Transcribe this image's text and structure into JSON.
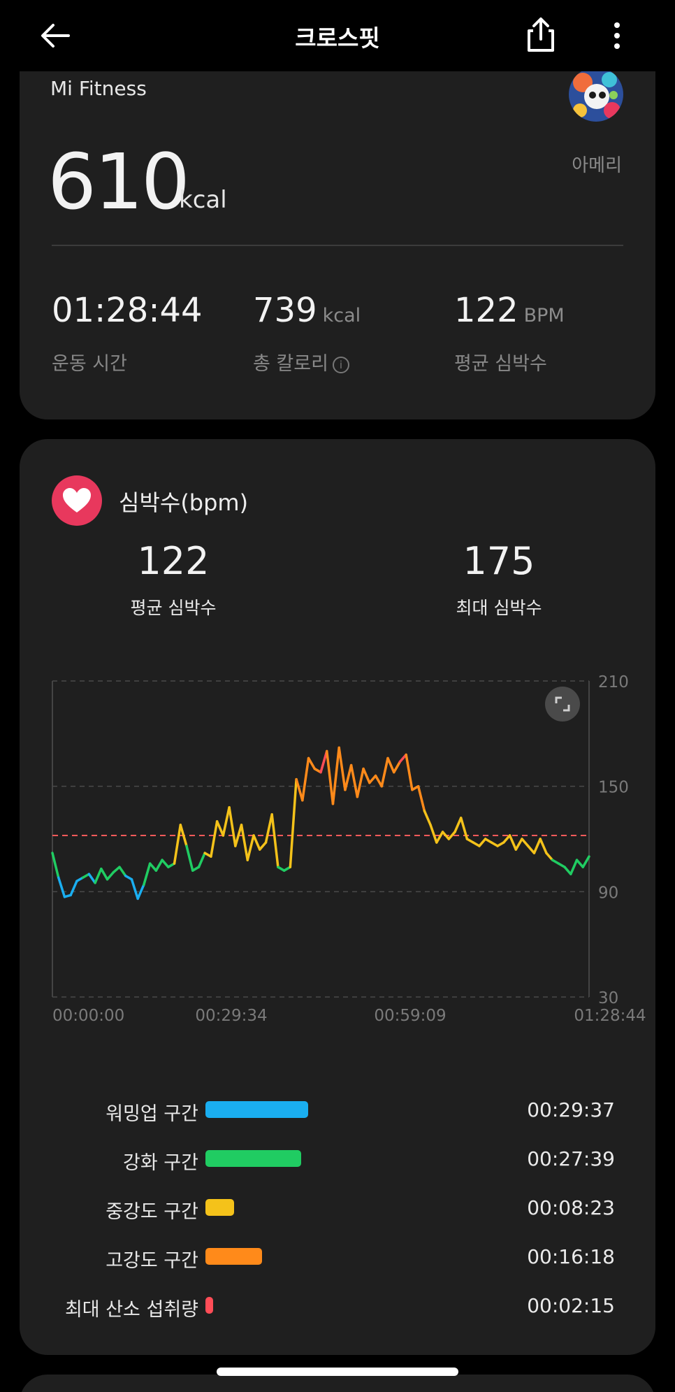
{
  "header": {
    "title": "크로스핏"
  },
  "summary": {
    "app_name": "Mi Fitness",
    "calories_value": "610",
    "calories_unit": "kcal",
    "source_label": "아메리",
    "stats": [
      {
        "value": "01:28:44",
        "unit": "",
        "label": "운동 시간"
      },
      {
        "value": "739",
        "unit": "kcal",
        "label": "총 칼로리"
      },
      {
        "value": "122",
        "unit": "BPM",
        "label": "평균 심박수"
      }
    ]
  },
  "heart_rate": {
    "title": "심박수(bpm)",
    "avg_value": "122",
    "avg_label": "평균 심박수",
    "max_value": "175",
    "max_label": "최대 심박수",
    "colors": {
      "warmup": "#1aaef0",
      "fat_burn": "#20cc62",
      "aerobic": "#f4c21a",
      "anaerobic": "#ff8a1a",
      "vo2max": "#ff4d57",
      "avg_line": "#ff5a5a",
      "heart_bg": "#e8385d"
    }
  },
  "chart_data": {
    "type": "line",
    "ylim": [
      30,
      210
    ],
    "yticks": [
      "210",
      "150",
      "90",
      "30"
    ],
    "xticks": [
      "00:00:00",
      "00:29:34",
      "00:59:09",
      "01:28:44"
    ],
    "avg_line": 122,
    "series": [
      {
        "x_minutes": [
          0,
          1,
          2,
          3,
          4,
          5,
          6,
          7,
          8,
          9,
          10,
          11,
          12,
          13,
          14,
          15,
          16,
          17,
          18,
          19,
          20,
          21,
          22,
          23,
          24,
          25,
          26,
          27,
          28,
          29,
          30,
          31,
          32,
          33,
          34,
          35,
          36,
          37,
          38,
          39,
          40,
          41,
          42,
          43,
          44,
          45,
          46,
          47,
          48,
          49,
          50,
          51,
          52,
          53,
          54,
          55,
          56,
          57,
          58,
          59,
          60,
          61,
          62,
          63,
          64,
          65,
          66,
          67,
          68,
          69,
          70,
          71,
          72,
          73,
          74,
          75,
          76,
          77,
          78,
          79,
          80,
          81,
          82,
          83,
          84,
          85,
          86,
          87,
          88
        ],
        "values": [
          112,
          98,
          87,
          88,
          96,
          98,
          100,
          95,
          103,
          97,
          101,
          104,
          99,
          97,
          86,
          94,
          106,
          102,
          108,
          104,
          106,
          128,
          116,
          102,
          104,
          112,
          110,
          130,
          122,
          138,
          116,
          128,
          108,
          122,
          114,
          118,
          134,
          104,
          102,
          104,
          154,
          142,
          166,
          160,
          158,
          170,
          140,
          172,
          148,
          162,
          144,
          160,
          152,
          156,
          150,
          166,
          158,
          164,
          168,
          148,
          150,
          136,
          128,
          118,
          124,
          120,
          124,
          132,
          120,
          118,
          116,
          120,
          118,
          116,
          118,
          122,
          114,
          120,
          116,
          112,
          120,
          112,
          108,
          106,
          104,
          100,
          108,
          104,
          110
        ]
      }
    ]
  },
  "zones": [
    {
      "label": "워밍업 구간",
      "time": "00:29:37",
      "fraction": 0.333,
      "color": "#1aaef0"
    },
    {
      "label": "강화 구간",
      "time": "00:27:39",
      "fraction": 0.311,
      "color": "#20cc62"
    },
    {
      "label": "중강도 구간",
      "time": "00:08:23",
      "fraction": 0.094,
      "color": "#f4c21a"
    },
    {
      "label": "고강도 구간",
      "time": "00:16:18",
      "fraction": 0.184,
      "color": "#ff8a1a"
    },
    {
      "label": "최대 산소 섭취량",
      "time": "00:02:15",
      "fraction": 0.025,
      "color": "#ff4d57"
    }
  ]
}
